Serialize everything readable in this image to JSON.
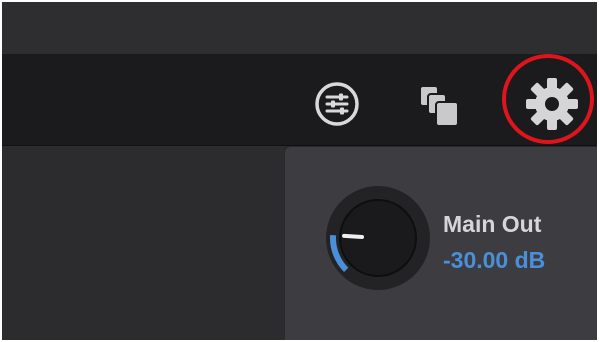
{
  "toolbar": {
    "buttons": [
      {
        "icon": "mixer-sliders-icon"
      },
      {
        "icon": "windows-stack-icon"
      },
      {
        "icon": "gear-icon"
      }
    ]
  },
  "output": {
    "label": "Main Out",
    "value": "-30.00 dB",
    "value_color": "#4a8fd8",
    "level_fraction": 0.18
  },
  "colors": {
    "highlight": "#e0141c",
    "accent": "#4a8fd8"
  }
}
